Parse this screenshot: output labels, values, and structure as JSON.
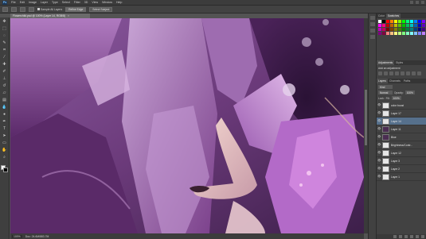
{
  "app": {
    "logo": "Ps"
  },
  "menu": [
    "File",
    "Edit",
    "Image",
    "Layer",
    "Type",
    "Select",
    "Filter",
    "3D",
    "View",
    "Window",
    "Help"
  ],
  "options": {
    "checks": [
      "Sample All Layers"
    ],
    "buttons": [
      "Refine Edge",
      "Select Subject"
    ]
  },
  "document": {
    "tab_title": "Flowerchild.psd @ 100% (Layer 14, RGB/8)"
  },
  "status": {
    "zoom": "100%",
    "doc_info": "Doc: 24.6M/883.7M"
  },
  "panels": {
    "top_tabs": [
      "Color",
      "Swatches"
    ],
    "adjust_tabs": [
      "Adjustments",
      "Styles"
    ],
    "adjust_title": "Add an adjustment",
    "layer_tabs": [
      "Layers",
      "Channels",
      "Paths"
    ],
    "kind_label": "Kind",
    "blend_mode": "Normal",
    "opacity_label": "Opacity:",
    "opacity_value": "100%",
    "lock_label": "Lock:",
    "fill_label": "Fill:",
    "fill_value": "100%"
  },
  "layers": [
    {
      "name": "color boost",
      "dark": false,
      "selected": false
    },
    {
      "name": "Layer 17",
      "dark": false,
      "selected": false
    },
    {
      "name": "Layer 14",
      "dark": false,
      "selected": true
    },
    {
      "name": "Layer 11",
      "dark": true,
      "selected": false
    },
    {
      "name": "Blue",
      "dark": true,
      "selected": false
    },
    {
      "name": "Brightness/Contr...",
      "dark": false,
      "selected": false
    },
    {
      "name": "Layer 12",
      "dark": false,
      "selected": false
    },
    {
      "name": "Layer 3",
      "dark": false,
      "selected": false
    },
    {
      "name": "Layer 2",
      "dark": false,
      "selected": false
    },
    {
      "name": "Layer 1",
      "dark": false,
      "selected": false
    }
  ],
  "swatch_colors": [
    "#ffffff",
    "#000000",
    "#ff0000",
    "#ff8000",
    "#ffff00",
    "#80ff00",
    "#00ff00",
    "#00ff80",
    "#00ffff",
    "#0080ff",
    "#0000ff",
    "#8000ff",
    "#ff00ff",
    "#ff0080",
    "#c00000",
    "#c06000",
    "#c0c000",
    "#60c000",
    "#00c000",
    "#00c060",
    "#00c0c0",
    "#0060c0",
    "#0000c0",
    "#6000c0",
    "#c000c0",
    "#c00060",
    "#800000",
    "#804000",
    "#808000",
    "#408000",
    "#008000",
    "#008040",
    "#008080",
    "#004080",
    "#000080",
    "#400080",
    "#800080",
    "#800040",
    "#ff8080",
    "#ffc080",
    "#ffff80",
    "#c0ff80",
    "#80ff80",
    "#80ffc0",
    "#80ffff",
    "#80c0ff",
    "#8080ff",
    "#c080ff"
  ],
  "colors": {
    "foreground": "#ffffff",
    "background": "#000000",
    "selection": "#56708c"
  }
}
